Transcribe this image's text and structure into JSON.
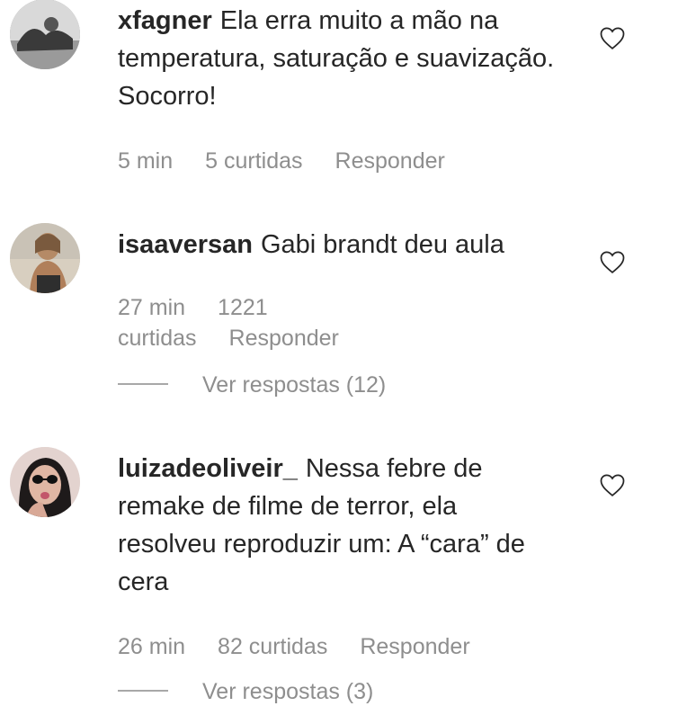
{
  "comments": [
    {
      "username": "xfagner",
      "text": "Ela erra muito a mão na temperatura, saturação e suavização. Socorro!",
      "time": "5 min",
      "likes": "5 curtidas",
      "reply": "Responder"
    },
    {
      "username": "isaaversan",
      "text": "Gabi brandt deu aula",
      "time": "27 min",
      "likes": "1221 curtidas",
      "reply": "Responder",
      "view_replies": "Ver respostas (12)"
    },
    {
      "username": "luizadeoliveir_",
      "text": "Nessa febre de remake de filme de terror, ela resolveu reproduzir um: A “cara” de cera",
      "time": "26 min",
      "likes": "82 curtidas",
      "reply": "Responder",
      "view_replies": "Ver respostas (3)"
    }
  ],
  "icons": {
    "like": "heart-outline-icon"
  }
}
